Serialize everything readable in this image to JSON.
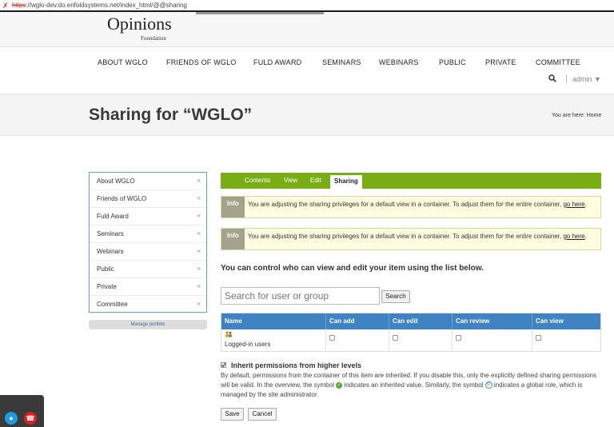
{
  "browser": {
    "url_scheme": "https",
    "url_rest": "://wglo-dev.do.enfoldsystems.net/index_html/@@sharing"
  },
  "site": {
    "logo_main": "Opinions",
    "logo_sub": "Foundation"
  },
  "nav": {
    "items": [
      "ABOUT WGLO",
      "FRIENDS OF WGLO",
      "FULD AWARD",
      "SEMINARS",
      "WEBINARS",
      "PUBLIC",
      "PRIVATE",
      "COMMITTEE"
    ]
  },
  "user_menu": {
    "username": "admin"
  },
  "page": {
    "title": "Sharing for “WGLO”",
    "breadcrumb": "You are here: Home"
  },
  "portlet": {
    "items": [
      "About WGLO",
      "Friends of WGLO",
      "Fuld Award",
      "Seminars",
      "Webinars",
      "Public",
      "Private",
      "Committee"
    ],
    "chevron": "»",
    "manage_label": "Manage portlets"
  },
  "tabs": {
    "items": [
      "Contents",
      "View",
      "Edit",
      "Sharing"
    ],
    "active": "Sharing"
  },
  "info_messages": [
    {
      "badge": "Info",
      "text": "You are adjusting the sharing privileges for a default view in a container. To adjust them for the entire container, ",
      "link": "go here",
      "end": "."
    },
    {
      "badge": "Info",
      "text": "You are adjusting the sharing privileges for a default view in a container. To adjust them for the entire container, ",
      "link": "go here",
      "end": "."
    }
  ],
  "sharing": {
    "lead": "You can control who can view and edit your item using the list below.",
    "search_placeholder": "Search for user or group",
    "search_button": "Search",
    "columns": [
      "Name",
      "Can add",
      "Can edit",
      "Can review",
      "Can view"
    ],
    "rows": [
      {
        "name": "Logged-in users",
        "can_add": false,
        "can_edit": false,
        "can_review": false,
        "can_view": false
      }
    ],
    "inherit_checked": true,
    "inherit_label": "Inherit permissions from higher levels",
    "inherit_desc_1": "By default, permissions from the container of this item are inherited. If you disable this, only the explicitly defined sharing permissions will be valid. In the overview, the symbol ",
    "inherit_desc_2": " indicates an inherited value. Similarly, the symbol ",
    "inherit_desc_3": " indicates a global role, which is managed by the site administrator.",
    "save_label": "Save",
    "cancel_label": "Cancel"
  },
  "colors": {
    "tab_bar": "#79ad14",
    "table_head": "#3f83c2",
    "info_bg": "#fffde0",
    "info_badge": "#a5a28b"
  }
}
